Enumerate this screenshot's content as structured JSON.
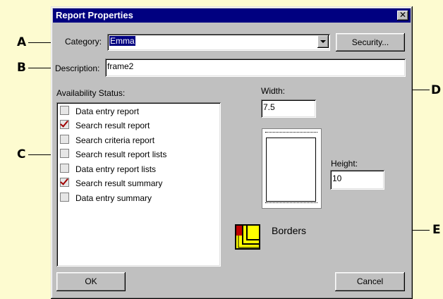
{
  "callouts": {
    "a": "A",
    "b": "B",
    "c": "C",
    "d": "D",
    "e": "E"
  },
  "dialog": {
    "title": "Report Properties",
    "close_glyph": "✕",
    "category_label": "Category:",
    "category_value": "Emma",
    "security_button": "Security...",
    "description_label": "Description:",
    "description_value": "frame2",
    "availability_label": "Availability Status:",
    "availability_items": [
      {
        "label": "Data entry report",
        "checked": false
      },
      {
        "label": "Search result report",
        "checked": true
      },
      {
        "label": "Search criteria report",
        "checked": false
      },
      {
        "label": "Search result report lists",
        "checked": false
      },
      {
        "label": "Data entry report lists",
        "checked": false
      },
      {
        "label": "Search result summary",
        "checked": true
      },
      {
        "label": "Data entry summary",
        "checked": false
      }
    ],
    "width_label": "Width:",
    "width_value": "7.5",
    "height_label": "Height:",
    "height_value": "10",
    "borders_label": "Borders",
    "ok_button": "OK",
    "cancel_button": "Cancel"
  },
  "colors": {
    "page_background": "#fdfbd0",
    "dialog_face": "#c0c0c0",
    "titlebar": "#000080",
    "check_mark": "#a00000",
    "borders_icon_yellow": "#ffff00",
    "borders_icon_red": "#c00000"
  },
  "icons": {
    "dropdown": "chevron-down-icon",
    "borders": "borders-icon",
    "close": "close-icon",
    "page_preview": "page-preview-icon"
  }
}
